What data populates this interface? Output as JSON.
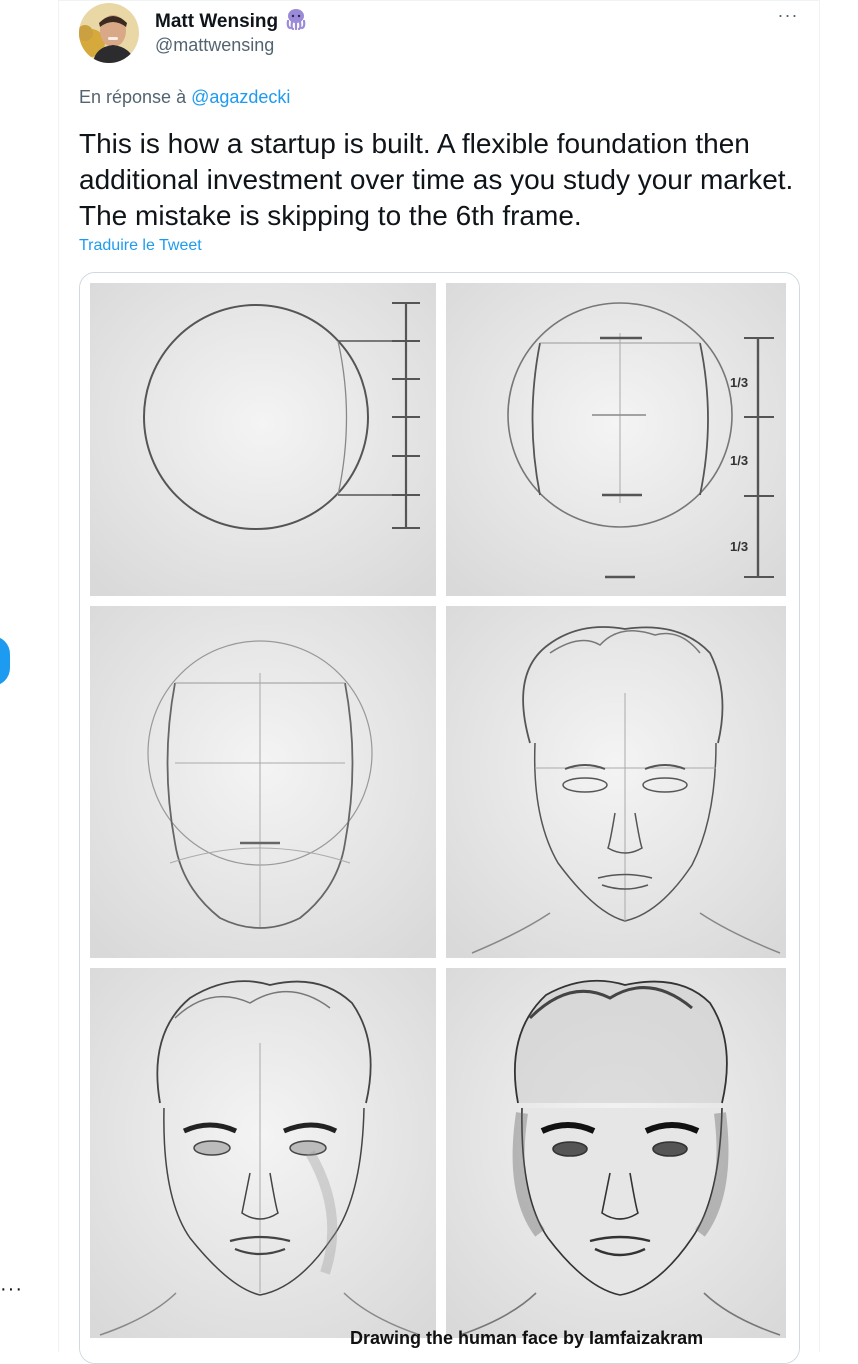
{
  "tweet": {
    "author_name": "Matt Wensing",
    "author_handle": "@mattwensing",
    "reply_prefix": "En réponse à",
    "reply_to": "@agazdecki",
    "text": "This is how a startup is built.  A flexible foundation then additional investment over time as you study your market. The mistake is skipping to the 6th frame.",
    "translate_label": "Traduire le Tweet",
    "more_label": "···"
  },
  "media": {
    "caption": "Drawing the human face by Iamfaizakram",
    "thirds_labels": [
      "1/3",
      "1/3",
      "1/3"
    ]
  },
  "page": {
    "left_edge_dots": "···"
  },
  "colors": {
    "link_blue": "#1d9bf0",
    "secondary_text": "#536471",
    "border": "#cfd9de"
  },
  "icons": [
    "octopus-emoji-icon",
    "more-options-icon"
  ]
}
